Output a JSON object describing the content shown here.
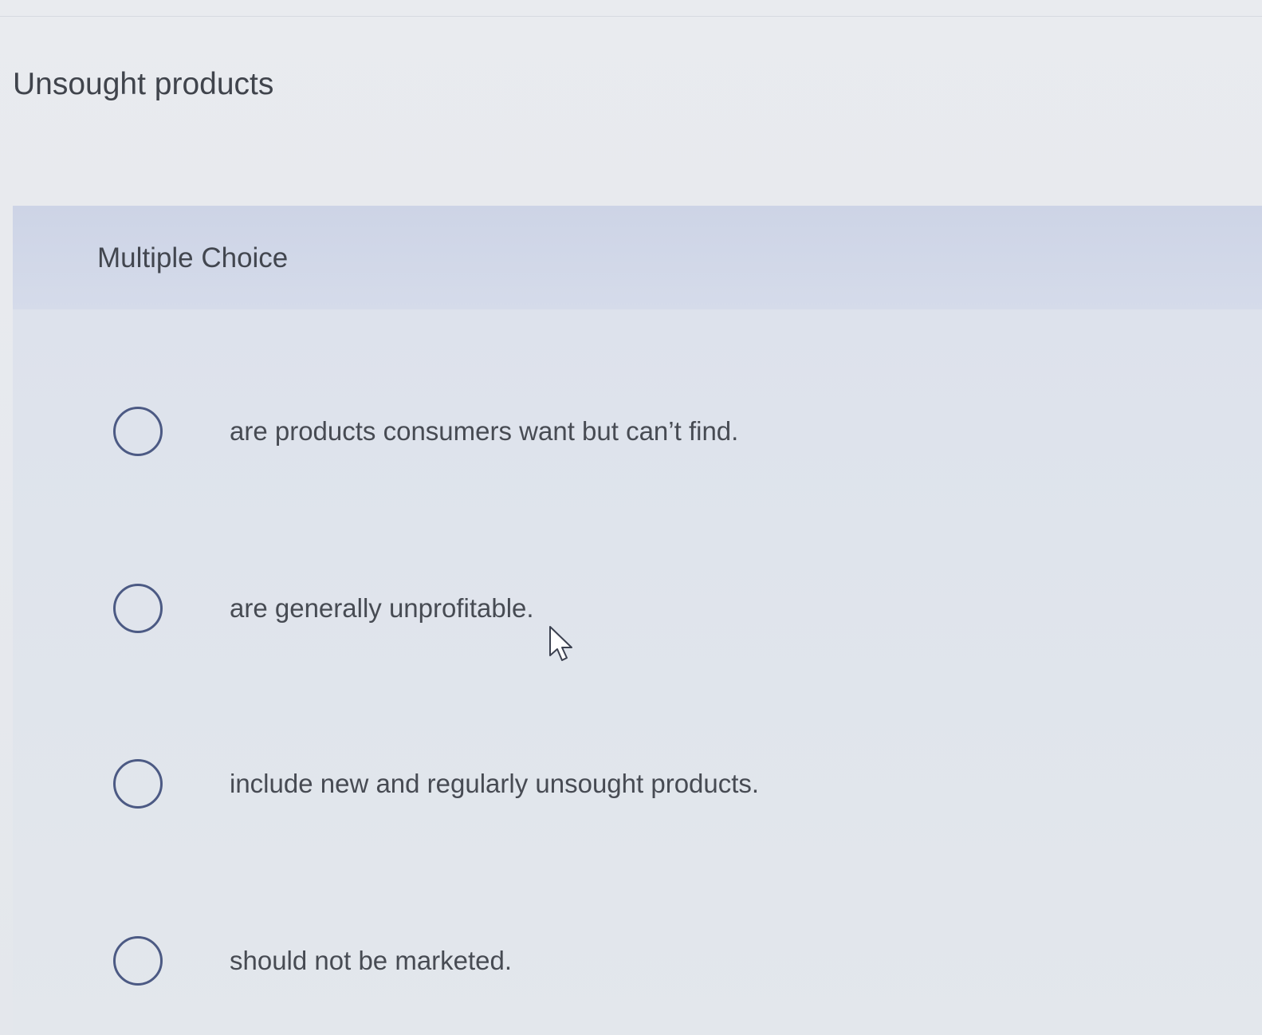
{
  "question": {
    "text": "Unsought products"
  },
  "choice_panel": {
    "header": "Multiple Choice",
    "options": [
      {
        "label": "are products consumers want but can’t find."
      },
      {
        "label": "are generally unprofitable."
      },
      {
        "label": "include new and regularly unsought products."
      },
      {
        "label": "should not be marketed."
      }
    ]
  },
  "icons": {
    "radio": "radio-circle-icon",
    "cursor": "mouse-pointer-icon"
  },
  "colors": {
    "radio_border": "#4c5a84",
    "header_band": "#cdd4e6",
    "text": "#474b53"
  }
}
